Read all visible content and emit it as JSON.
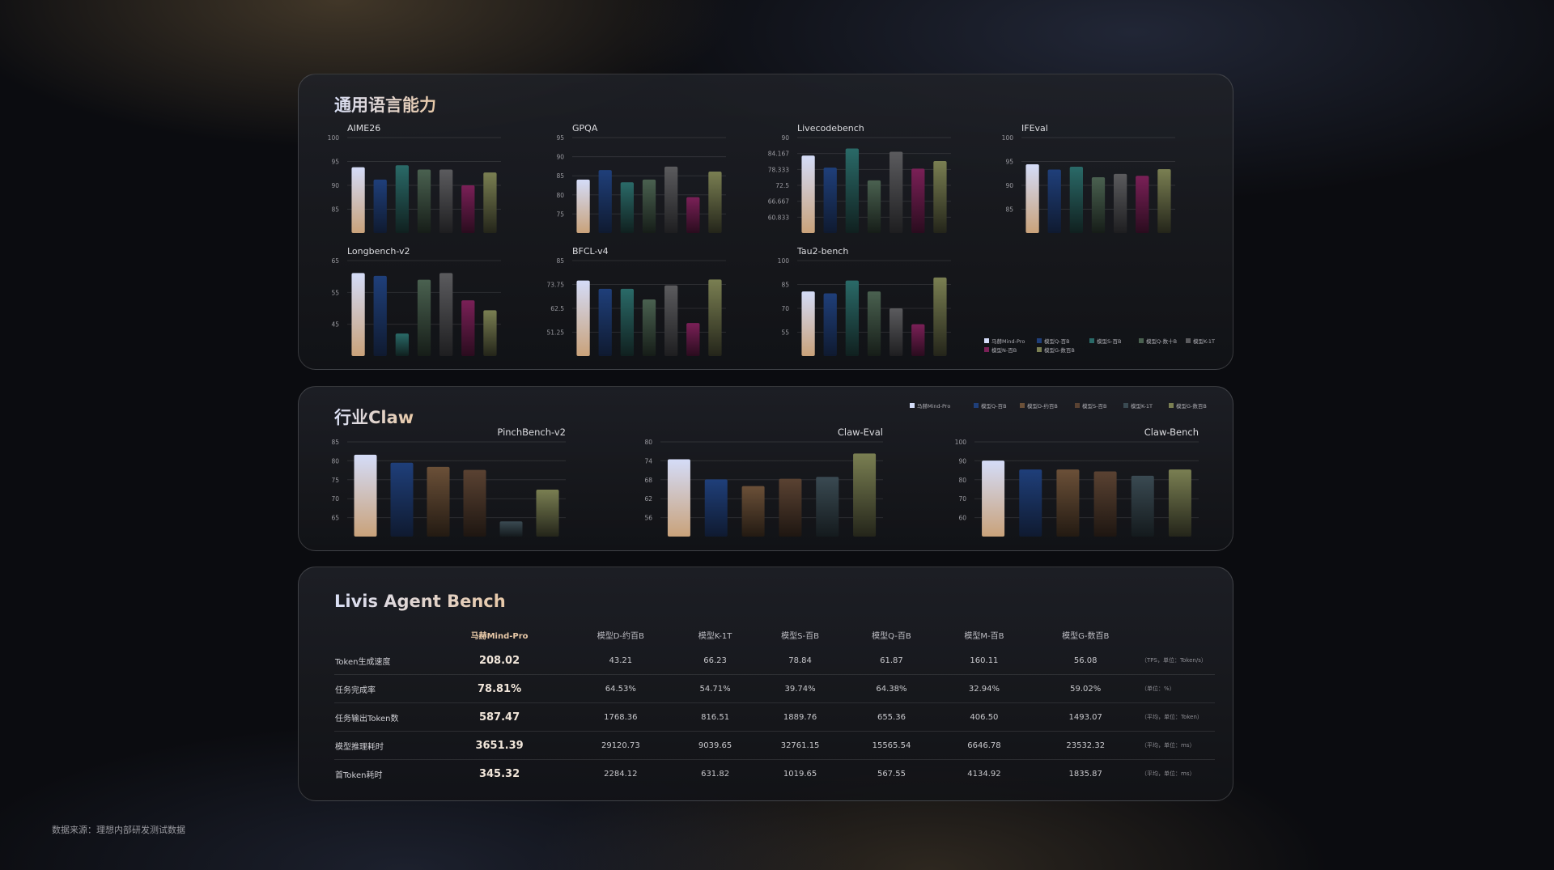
{
  "panel1": {
    "title": "通用语言能力",
    "legend": [
      "马赫Mind-Pro",
      "模型Q-百B",
      "模型S-百B",
      "模型Q-数十B",
      "模型K-1T",
      "模型N-百B",
      "模型G-数百B"
    ]
  },
  "panel2": {
    "title": "行业Claw",
    "legend": [
      "马赫Mind-Pro",
      "模型Q-百B",
      "模型D-约百B",
      "模型S-百B",
      "模型K-1T",
      "模型G-数百B"
    ]
  },
  "panel3": {
    "title": "Livis Agent Bench",
    "columns": [
      "马赫Mind-Pro",
      "模型D-约百B",
      "模型K-1T",
      "模型S-百B",
      "模型Q-百B",
      "模型M-百B",
      "模型G-数百B"
    ],
    "rows": [
      {
        "label": "Token生成速度",
        "values": [
          "208.02",
          "43.21",
          "66.23",
          "78.84",
          "61.87",
          "160.11",
          "56.08"
        ],
        "unit": "（TPS，单位：Token/s）"
      },
      {
        "label": "任务完成率",
        "values": [
          "78.81%",
          "64.53%",
          "54.71%",
          "39.74%",
          "64.38%",
          "32.94%",
          "59.02%"
        ],
        "unit": "（单位：%）"
      },
      {
        "label": "任务输出Token数",
        "values": [
          "587.47",
          "1768.36",
          "816.51",
          "1889.76",
          "655.36",
          "406.50",
          "1493.07"
        ],
        "unit": "（平均，单位：Token）"
      },
      {
        "label": "模型推理耗时",
        "values": [
          "3651.39",
          "29120.73",
          "9039.65",
          "32761.15",
          "15565.54",
          "6646.78",
          "23532.32"
        ],
        "unit": "（平均，单位：ms）"
      },
      {
        "label": "首Token耗时",
        "values": [
          "345.32",
          "2284.12",
          "631.82",
          "1019.65",
          "567.55",
          "4134.92",
          "1835.87"
        ],
        "unit": "（平均，单位：ms）"
      }
    ]
  },
  "footer": {
    "source": "数据来源：理想内部研发测试数据"
  },
  "colors": {
    "马赫Mind-Pro": [
      "#d4dcf8",
      "#c9a27a"
    ],
    "模型Q-百B": [
      "#1f3f7a",
      "#0f1a30"
    ],
    "模型S-百B": [
      "#2a6a68",
      "#10201f"
    ],
    "模型Q-数十B": [
      "#4a6150",
      "#161d18"
    ],
    "模型K-1T": [
      "#5b5b5e",
      "#1e1e20"
    ],
    "模型N-百B": [
      "#7a2057",
      "#2a0c1e"
    ],
    "模型G-数百B": [
      "#7a7f52",
      "#24251a"
    ],
    "模型D-约百B": [
      "#6b5038",
      "#231a12"
    ],
    "ind-S": [
      "#5a4232",
      "#1e1611"
    ],
    "ind-K": [
      "#3a4a52",
      "#141a1d"
    ]
  },
  "chart_data": [
    {
      "type": "bar",
      "title": "AIME26",
      "ylim": [
        80,
        100
      ],
      "yticks": [
        "100",
        "95",
        "90",
        "85"
      ],
      "series": [
        {
          "name": "马赫Mind-Pro",
          "values": [
            93.8
          ]
        },
        {
          "name": "模型Q-百B",
          "values": [
            91.2
          ]
        },
        {
          "name": "模型S-百B",
          "values": [
            94.2
          ]
        },
        {
          "name": "模型Q-数十B",
          "values": [
            93.3
          ]
        },
        {
          "name": "模型K-1T",
          "values": [
            93.3
          ]
        },
        {
          "name": "模型N-百B",
          "values": [
            90.0
          ]
        },
        {
          "name": "模型G-数百B",
          "values": [
            92.7
          ]
        }
      ]
    },
    {
      "type": "bar",
      "title": "GPQA",
      "ylim": [
        70,
        95
      ],
      "yticks": [
        "95",
        "90",
        "85",
        "80",
        "75"
      ],
      "series": [
        {
          "name": "马赫Mind-Pro",
          "values": [
            84.0
          ]
        },
        {
          "name": "模型Q-百B",
          "values": [
            86.5
          ]
        },
        {
          "name": "模型S-百B",
          "values": [
            83.3
          ]
        },
        {
          "name": "模型Q-数十B",
          "values": [
            84.0
          ]
        },
        {
          "name": "模型K-1T",
          "values": [
            87.4
          ]
        },
        {
          "name": "模型N-百B",
          "values": [
            79.4
          ]
        },
        {
          "name": "模型G-数百B",
          "values": [
            86.1
          ]
        }
      ]
    },
    {
      "type": "bar",
      "title": "Livecodebench",
      "ylim": [
        55,
        90
      ],
      "yticks": [
        "90",
        "84.167",
        "78.333",
        "72.5",
        "66.667",
        "60.833"
      ],
      "series": [
        {
          "name": "马赫Mind-Pro",
          "values": [
            83.4
          ]
        },
        {
          "name": "模型Q-百B",
          "values": [
            79.0
          ]
        },
        {
          "name": "模型S-百B",
          "values": [
            86.0
          ]
        },
        {
          "name": "模型Q-数十B",
          "values": [
            74.3
          ]
        },
        {
          "name": "模型K-1T",
          "values": [
            84.8
          ]
        },
        {
          "name": "模型N-百B",
          "values": [
            78.6
          ]
        },
        {
          "name": "模型G-数百B",
          "values": [
            81.4
          ]
        }
      ]
    },
    {
      "type": "bar",
      "title": "IFEval",
      "ylim": [
        80,
        100
      ],
      "yticks": [
        "100",
        "95",
        "90",
        "85"
      ],
      "series": [
        {
          "name": "马赫Mind-Pro",
          "values": [
            94.4
          ]
        },
        {
          "name": "模型Q-百B",
          "values": [
            93.3
          ]
        },
        {
          "name": "模型S-百B",
          "values": [
            93.9
          ]
        },
        {
          "name": "模型Q-数十B",
          "values": [
            91.7
          ]
        },
        {
          "name": "模型K-1T",
          "values": [
            92.4
          ]
        },
        {
          "name": "模型N-百B",
          "values": [
            92.0
          ]
        },
        {
          "name": "模型G-数百B",
          "values": [
            93.4
          ]
        }
      ]
    },
    {
      "type": "bar",
      "title": "Longbench-v2",
      "ylim": [
        35,
        65
      ],
      "yticks": [
        "65",
        "55",
        "45"
      ],
      "series": [
        {
          "name": "马赫Mind-Pro",
          "values": [
            61.1
          ]
        },
        {
          "name": "模型Q-百B",
          "values": [
            60.2
          ]
        },
        {
          "name": "模型S-百B",
          "values": [
            42.1
          ]
        },
        {
          "name": "模型Q-数十B",
          "values": [
            59.0
          ]
        },
        {
          "name": "模型K-1T",
          "values": [
            61.1
          ]
        },
        {
          "name": "模型N-百B",
          "values": [
            52.5
          ]
        },
        {
          "name": "模型G-数百B",
          "values": [
            49.4
          ]
        }
      ]
    },
    {
      "type": "bar",
      "title": "BFCL-v4",
      "ylim": [
        40,
        85
      ],
      "yticks": [
        "85",
        "73.75",
        "62.5",
        "51.25"
      ],
      "series": [
        {
          "name": "马赫Mind-Pro",
          "values": [
            75.6
          ]
        },
        {
          "name": "模型Q-百B",
          "values": [
            71.7
          ]
        },
        {
          "name": "模型S-百B",
          "values": [
            71.7
          ]
        },
        {
          "name": "模型Q-数十B",
          "values": [
            66.7
          ]
        },
        {
          "name": "模型K-1T",
          "values": [
            73.3
          ]
        },
        {
          "name": "模型N-百B",
          "values": [
            55.6
          ]
        },
        {
          "name": "模型G-数百B",
          "values": [
            76.1
          ]
        }
      ]
    },
    {
      "type": "bar",
      "title": "Tau2-bench",
      "ylim": [
        40,
        100
      ],
      "yticks": [
        "100",
        "85",
        "70",
        "55"
      ],
      "series": [
        {
          "name": "马赫Mind-Pro",
          "values": [
            80.6
          ]
        },
        {
          "name": "模型Q-百B",
          "values": [
            79.4
          ]
        },
        {
          "name": "模型S-百B",
          "values": [
            87.5
          ]
        },
        {
          "name": "模型Q-数十B",
          "values": [
            80.6
          ]
        },
        {
          "name": "模型K-1T",
          "values": [
            70.0
          ]
        },
        {
          "name": "模型N-百B",
          "values": [
            60.0
          ]
        },
        {
          "name": "模型G-数百B",
          "values": [
            89.4
          ]
        }
      ]
    },
    {
      "type": "bar",
      "title": "PinchBench-v2",
      "ylim": [
        60,
        85
      ],
      "yticks": [
        "85",
        "80",
        "75",
        "70",
        "65"
      ],
      "series": [
        {
          "name": "马赫Mind-Pro",
          "values": [
            81.6
          ]
        },
        {
          "name": "模型Q-百B",
          "values": [
            79.5
          ]
        },
        {
          "name": "模型D-约百B",
          "values": [
            78.4
          ]
        },
        {
          "name": "模型S-百B",
          "values": [
            77.6
          ]
        },
        {
          "name": "模型K-1T",
          "values": [
            64.0
          ]
        },
        {
          "name": "模型G-数百B",
          "values": [
            72.4
          ]
        }
      ]
    },
    {
      "type": "bar",
      "title": "Claw-Eval",
      "ylim": [
        50,
        80
      ],
      "yticks": [
        "80",
        "74",
        "68",
        "62",
        "56"
      ],
      "series": [
        {
          "name": "马赫Mind-Pro",
          "values": [
            74.5
          ]
        },
        {
          "name": "模型Q-百B",
          "values": [
            68.1
          ]
        },
        {
          "name": "模型D-约百B",
          "values": [
            66.0
          ]
        },
        {
          "name": "模型S-百B",
          "values": [
            68.3
          ]
        },
        {
          "name": "模型K-1T",
          "values": [
            68.9
          ]
        },
        {
          "name": "模型G-数百B",
          "values": [
            76.3
          ]
        }
      ]
    },
    {
      "type": "bar",
      "title": "Claw-Bench",
      "ylim": [
        50,
        100
      ],
      "yticks": [
        "100",
        "90",
        "80",
        "70",
        "60"
      ],
      "series": [
        {
          "name": "马赫Mind-Pro",
          "values": [
            90.1
          ]
        },
        {
          "name": "模型Q-百B",
          "values": [
            85.4
          ]
        },
        {
          "name": "模型D-约百B",
          "values": [
            85.4
          ]
        },
        {
          "name": "模型S-百B",
          "values": [
            84.4
          ]
        },
        {
          "name": "模型K-1T",
          "values": [
            82.1
          ]
        },
        {
          "name": "模型G-数百B",
          "values": [
            85.4
          ]
        }
      ]
    }
  ]
}
